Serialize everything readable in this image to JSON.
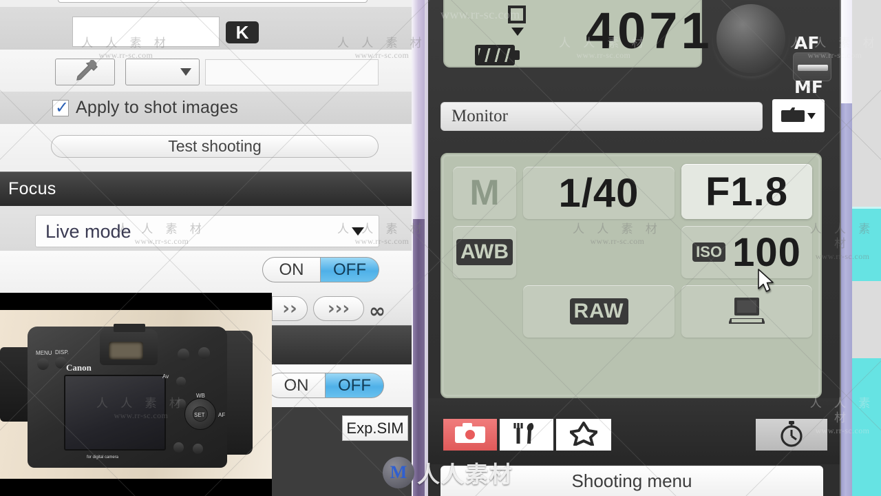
{
  "left_panel": {
    "k_badge": "K",
    "white_balance": {
      "eyedropper_icon": "eyedropper-icon",
      "dropdown_value": "",
      "value_field": ""
    },
    "apply_to_shot_images": {
      "label": "Apply to shot images",
      "checked": true,
      "check_glyph": "✓"
    },
    "test_shooting_label": "Test shooting",
    "focus_section": {
      "header": "Focus",
      "live_mode_value": "Live mode",
      "af_toggle": {
        "on": "ON",
        "off": "OFF",
        "selected": "OFF"
      },
      "focus_step_buttons": [
        "››",
        "›››"
      ],
      "infinity_symbol": "∞"
    },
    "second_toggle": {
      "on": "ON",
      "off": "OFF",
      "selected": "OFF"
    },
    "exp_sim_label": "Exp.SIM",
    "camera_photo": {
      "brand": "Canon",
      "button_labels": [
        "MENU",
        "DISP.",
        "Av",
        "WB",
        "SET",
        "AF"
      ],
      "footer_text": "for digital camera"
    }
  },
  "right_panel": {
    "top_lcd": {
      "shots_remaining": "4071",
      "battery_icon": "battery-full-icon",
      "single_shot_icon": "single-frame-icon"
    },
    "af_mf_switch": {
      "top_label": "AF",
      "bottom_label": "MF"
    },
    "monitor_field": {
      "value": "Monitor"
    },
    "folder_button_icon": "folder-icon",
    "settings_lcd": {
      "mode": "M",
      "shutter_speed": "1/40",
      "aperture": "F1.8",
      "white_balance": "AWB",
      "iso_label": "ISO",
      "iso_value": "100",
      "image_quality": "RAW",
      "destination_icon": "computer-icon"
    },
    "tabs": [
      {
        "name": "shooting",
        "icon": "camera-icon",
        "active": true
      },
      {
        "name": "setup",
        "icon": "tools-icon",
        "active": false
      },
      {
        "name": "my-menu",
        "icon": "star-icon",
        "active": false
      }
    ],
    "timer_button_icon": "stopwatch-icon",
    "menu_title": "Shooting menu"
  },
  "watermark": {
    "cn": "人 人 素 材",
    "en": "www.rr-sc.com",
    "logo_letter": "M",
    "logo_text": "人人素材"
  },
  "colors": {
    "lcd_green": "#b8c2b0",
    "toggle_blue": "#4fb0e8",
    "tab_active_red": "#e05a5a",
    "scrollbar_purple": "#6b5a84",
    "teal_edge": "#66e3e3"
  }
}
